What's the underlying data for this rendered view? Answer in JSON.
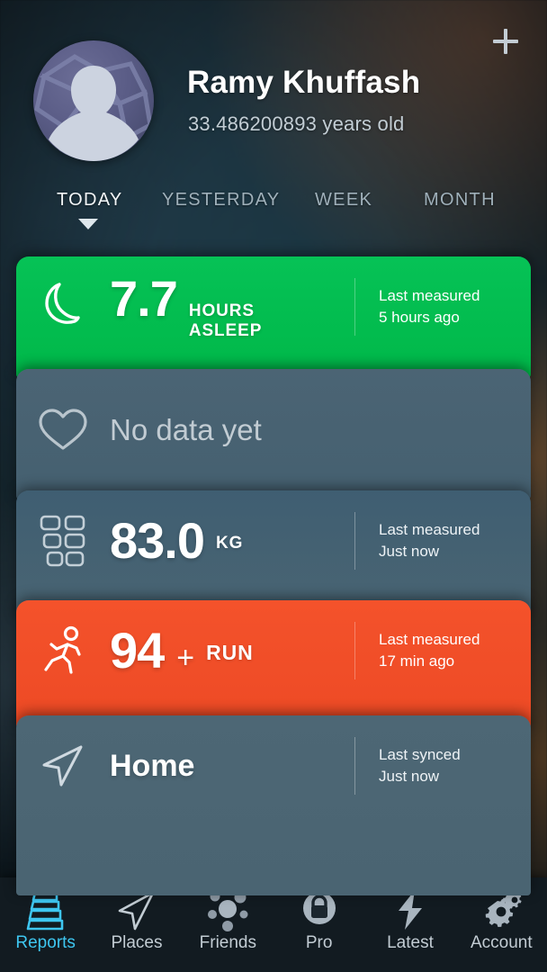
{
  "header": {
    "add_button": "+",
    "add_icon": "plus-icon",
    "avatar_icon": "default-avatar-silhouette",
    "user_name": "Ramy Khuffash",
    "user_age": "33.486200893 years old"
  },
  "periods": {
    "items": [
      {
        "label": "TODAY",
        "active": true
      },
      {
        "label": "YESTERDAY",
        "active": false
      },
      {
        "label": "WEEK",
        "active": false
      },
      {
        "label": "MONTH",
        "active": false
      }
    ],
    "caret_icon": "triangle-down-icon"
  },
  "cards": [
    {
      "id": "sleep",
      "icon": "moon-icon",
      "value": "7.7",
      "unit": "HOURS\nASLEEP",
      "meta_label": "Last measured",
      "meta_value": "5 hours ago",
      "color": "#06C256"
    },
    {
      "id": "heart",
      "icon": "heart-icon",
      "empty_text": "No data yet",
      "color": "#4B6474"
    },
    {
      "id": "weight",
      "icon": "body-composition-icon",
      "value": "83.0",
      "unit": "KG",
      "meta_label": "Last measured",
      "meta_value": "Just now",
      "color": "#3F5E72"
    },
    {
      "id": "activity",
      "icon": "runner-icon",
      "value": "94",
      "unit_prefix": "+",
      "unit": "RUN",
      "meta_label": "Last measured",
      "meta_value": "17 min ago",
      "color": "#F4522B"
    },
    {
      "id": "location",
      "icon": "navigation-arrow-icon",
      "value": "Home",
      "meta_label": "Last synced",
      "meta_value": "Just now",
      "color": "#4D6775"
    }
  ],
  "tabbar": {
    "active_color": "#3EC6F0",
    "items": [
      {
        "label": "Reports",
        "icon": "layers-stack-icon",
        "active": true
      },
      {
        "label": "Places",
        "icon": "navigation-arrow-icon",
        "active": false
      },
      {
        "label": "Friends",
        "icon": "friends-cluster-icon",
        "active": false
      },
      {
        "label": "Pro",
        "icon": "lock-icon",
        "active": false
      },
      {
        "label": "Latest",
        "icon": "lightning-bolt-icon",
        "active": false
      },
      {
        "label": "Account",
        "icon": "gears-icon",
        "active": false
      }
    ]
  }
}
